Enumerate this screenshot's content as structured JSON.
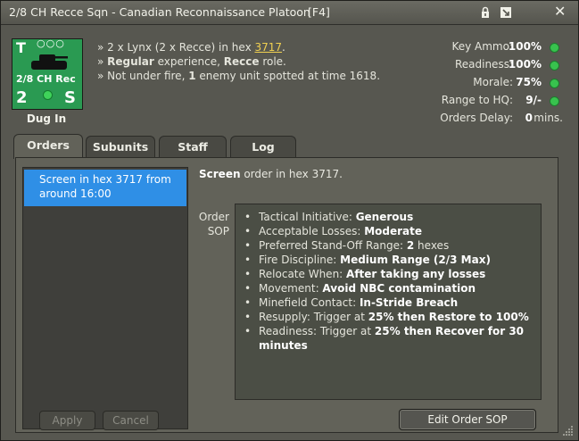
{
  "titlebar": {
    "title": "2/8 CH Recce Sqn - Canadian Reconnaissance Platoon",
    "hotkey": "[F4]",
    "lock_icon": "lock-icon",
    "minimize_icon": "minimize-icon",
    "close_label": "✕"
  },
  "counter": {
    "type_letter": "T",
    "size_dots": "○○○",
    "name": "2/8 CH Rec",
    "number": "2",
    "role_letter": "S",
    "icon": "tank-silhouette-icon",
    "color": "#2a9a52"
  },
  "status_label": "Dug In",
  "info": {
    "line1_pre": "» 2 x Lynx (2 x Recce) in hex ",
    "line1_hex": "3717",
    "line1_post": ".",
    "line2_bold1": "Regular",
    "line2_mid": " experience, ",
    "line2_bold2": "Recce",
    "line2_post": " role.",
    "line3_pre": "» Not under fire, ",
    "line3_bold": "1",
    "line3_post": " enemy unit spotted at time 1618.",
    "line2_pre": "» "
  },
  "stats": [
    {
      "label": "Key Ammo:",
      "value": "100%",
      "indicator": "green"
    },
    {
      "label": "Readiness:",
      "value": "100%",
      "indicator": "green"
    },
    {
      "label": "Morale:",
      "value": "75%",
      "indicator": "green"
    },
    {
      "label": "Range to HQ:",
      "value": "9/-",
      "indicator": "green"
    },
    {
      "label": "Orders Delay:",
      "value": "0",
      "unit": "mins."
    }
  ],
  "tabs": [
    {
      "label": "Orders",
      "active": true
    },
    {
      "label": "Subunits",
      "active": false
    },
    {
      "label": "Staff",
      "active": false
    },
    {
      "label": "Log",
      "active": false
    }
  ],
  "orders_list": [
    {
      "label": "Screen in hex 3717 from around 16:00",
      "selected": true
    }
  ],
  "order_description": {
    "bold": "Screen",
    "rest": " order in hex 3717."
  },
  "sop": {
    "label": "Order SOP",
    "items": [
      {
        "text": "Tactical Initiative: ",
        "bold": "Generous"
      },
      {
        "text": "Acceptable Losses: ",
        "bold": "Moderate"
      },
      {
        "text": "Preferred Stand-Off Range: ",
        "bold": "2",
        "suffix": " hexes"
      },
      {
        "text": "Fire Discipline: ",
        "bold": "Medium Range (2/3 Max)"
      },
      {
        "text": "Relocate When: ",
        "bold": "After taking any losses"
      },
      {
        "text": "Movement: ",
        "bold": "Avoid NBC contamination"
      },
      {
        "text": "Minefield Contact: ",
        "bold": "In-Stride Breach"
      },
      {
        "text": "Resupply: Trigger at ",
        "bold": "25% then Restore to 100%"
      },
      {
        "text": "Readiness: Trigger at ",
        "bold": "25% then Recover for 30 minutes"
      }
    ]
  },
  "buttons": {
    "apply": "Apply",
    "cancel": "Cancel",
    "edit_sop": "Edit Order SOP"
  },
  "colors": {
    "window_bg": "#575750",
    "selection": "#2f8fe6",
    "hex_link": "#f0d050",
    "indicator_green": "#38c24e"
  }
}
